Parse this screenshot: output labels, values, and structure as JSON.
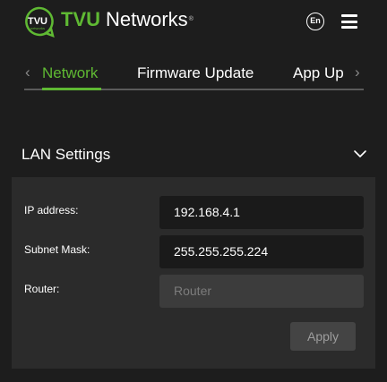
{
  "header": {
    "logo_text": "TVU",
    "logo_subtext": "networks",
    "brand_primary": "TVU",
    "brand_secondary": "Networks",
    "brand_mark": "®",
    "language_button": "En",
    "menu_icon": "hamburger-menu-icon"
  },
  "tabs": [
    {
      "label": "Network",
      "active": true
    },
    {
      "label": "Firmware Update",
      "active": false
    },
    {
      "label": "App Up",
      "active": false
    }
  ],
  "section": {
    "title": "LAN Settings",
    "expanded": true
  },
  "form": {
    "ip_label": "IP address:",
    "ip_value": "192.168.4.1",
    "subnet_label": "Subnet Mask:",
    "subnet_value": "255.255.255.224",
    "router_label": "Router:",
    "router_placeholder": "Router",
    "apply_label": "Apply"
  },
  "colors": {
    "accent": "#5fb933",
    "background": "#1d1d1d",
    "panel": "#2b2b2b",
    "input_filled": "#1a1a1a",
    "input_empty": "#3c3c3c"
  }
}
